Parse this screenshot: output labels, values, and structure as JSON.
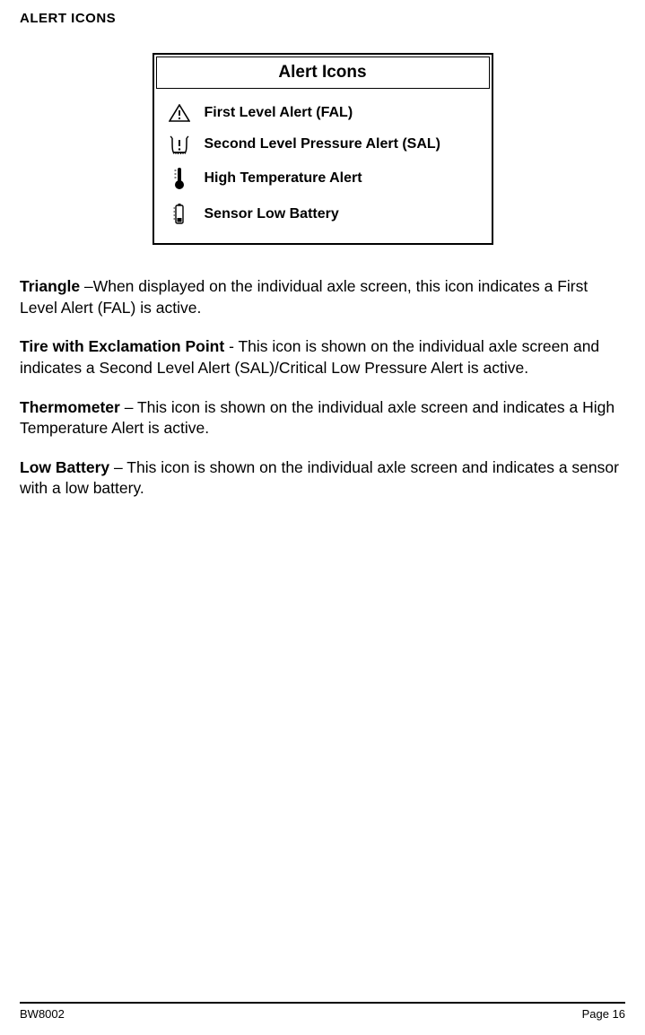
{
  "section_title": "ALERT ICONS",
  "table": {
    "header": "Alert Icons",
    "rows": [
      {
        "icon": "triangle-alert-icon",
        "label": "First Level Alert (FAL)"
      },
      {
        "icon": "tire-exclamation-icon",
        "label": "Second Level Pressure Alert (SAL)"
      },
      {
        "icon": "thermometer-icon",
        "label": "High Temperature Alert"
      },
      {
        "icon": "low-battery-icon",
        "label": "Sensor Low Battery"
      }
    ]
  },
  "paragraphs": [
    {
      "term": "Triangle",
      "text": " –When displayed on the individual axle screen, this icon indicates a First Level Alert (FAL) is active."
    },
    {
      "term": "Tire with Exclamation Point",
      "text": " - This icon is shown on the individual axle screen and indicates a Second Level Alert (SAL)/Critical Low Pressure Alert is active."
    },
    {
      "term": "Thermometer",
      "text": " – This icon is shown on the individual axle screen and indicates a High Temperature Alert is active."
    },
    {
      "term": "Low Battery",
      "text": " – This icon is shown on the individual axle screen and indicates a sensor with a low battery."
    }
  ],
  "footer": {
    "left": "BW8002",
    "right": "Page 16"
  }
}
